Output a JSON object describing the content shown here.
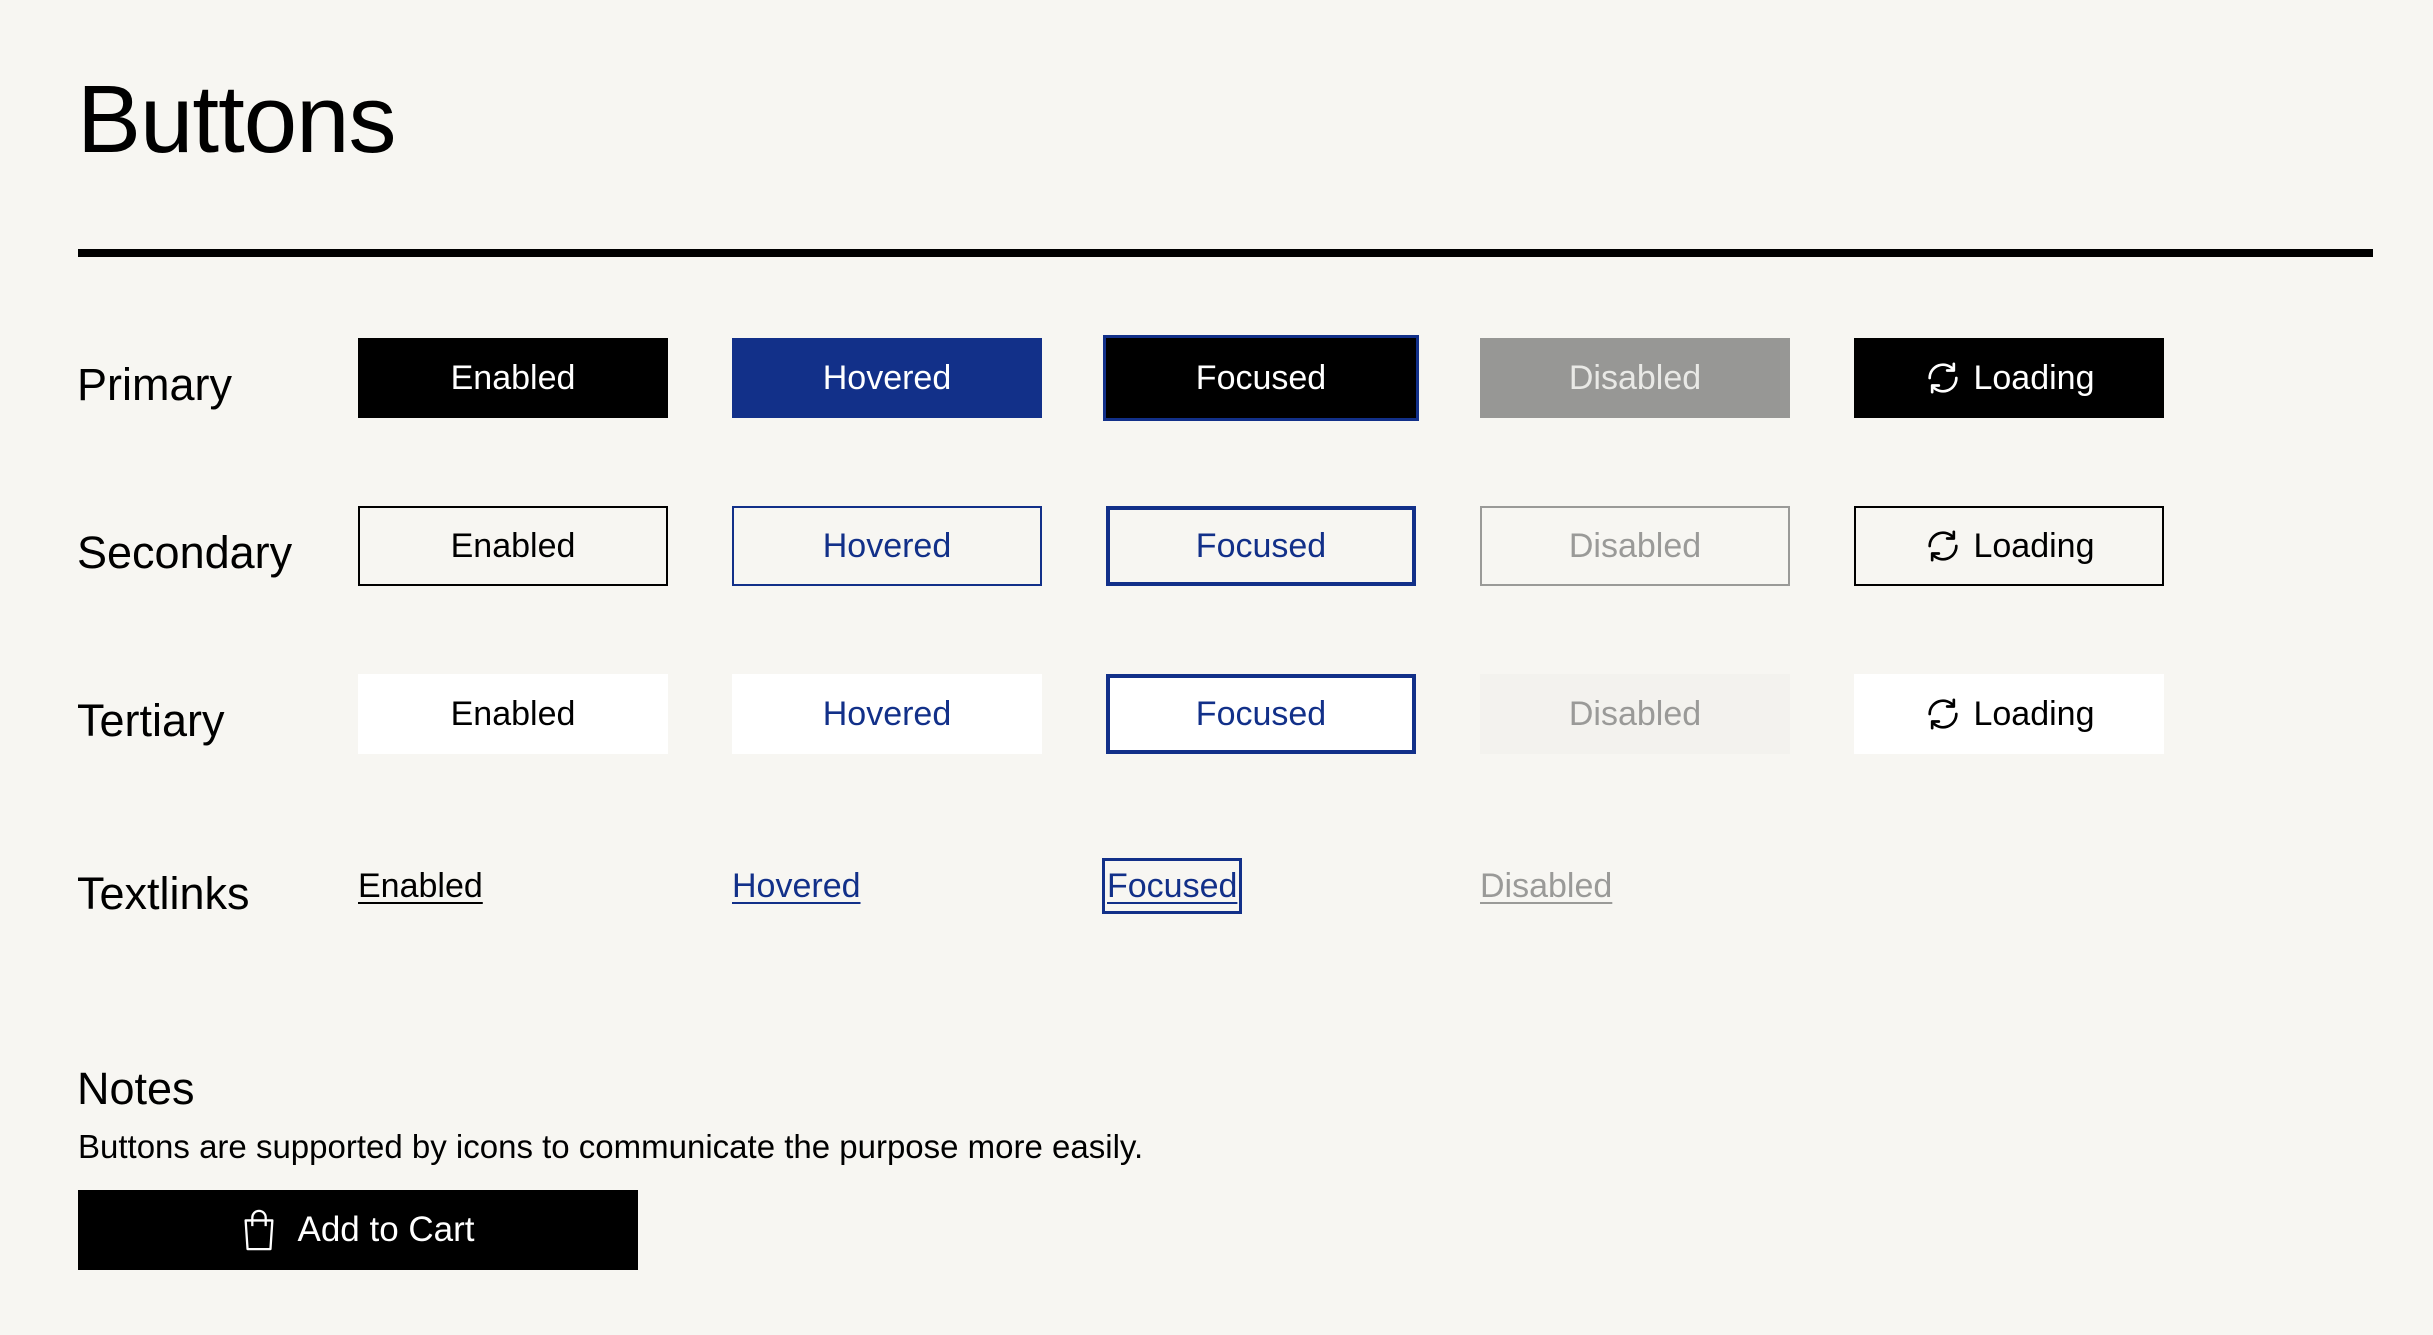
{
  "page": {
    "title": "Buttons"
  },
  "rows": {
    "primary": {
      "label": "Primary",
      "enabled": "Enabled",
      "hovered": "Hovered",
      "focused": "Focused",
      "disabled": "Disabled",
      "loading": "Loading"
    },
    "secondary": {
      "label": "Secondary",
      "enabled": "Enabled",
      "hovered": "Hovered",
      "focused": "Focused",
      "disabled": "Disabled",
      "loading": "Loading"
    },
    "tertiary": {
      "label": "Tertiary",
      "enabled": "Enabled",
      "hovered": "Hovered",
      "focused": "Focused",
      "disabled": "Disabled",
      "loading": "Loading"
    },
    "textlinks": {
      "label": "Textlinks",
      "enabled": "Enabled",
      "hovered": "Hovered",
      "focused": "Focused",
      "disabled": "Disabled"
    }
  },
  "notes": {
    "heading": "Notes",
    "text": "Buttons are supported by icons to communicate the purpose more easily.",
    "cart_button": "Add to Cart",
    "cart_icon": "shopping-bag-icon"
  },
  "icons": {
    "loading": "refresh-icon"
  },
  "colors": {
    "background": "#f7f6f2",
    "primary": "#000000",
    "hover_blue": "#123089",
    "disabled_gray": "#979795",
    "tertiary_bg": "#ffffff"
  }
}
